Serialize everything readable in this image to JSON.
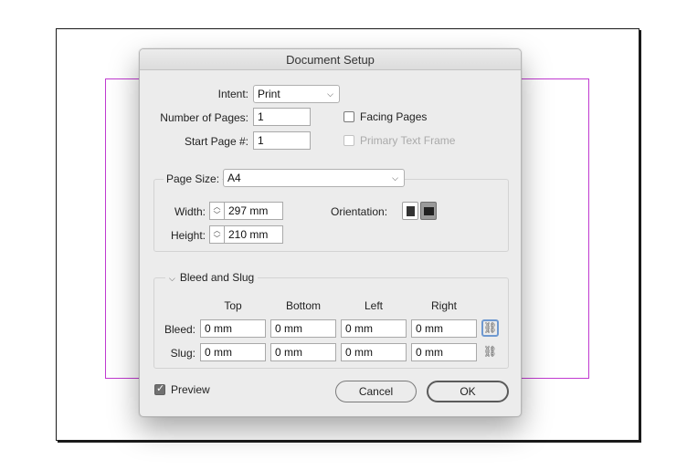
{
  "dialog": {
    "title": "Document Setup",
    "intent_label": "Intent:",
    "intent_value": "Print",
    "num_pages_label": "Number of Pages:",
    "num_pages_value": "1",
    "start_page_label": "Start Page #:",
    "start_page_value": "1",
    "facing_pages_label": "Facing Pages",
    "facing_pages_checked": false,
    "primary_text_frame_label": "Primary Text Frame",
    "primary_text_frame_checked": false,
    "page_size_label": "Page Size:",
    "page_size_value": "A4",
    "width_label": "Width:",
    "width_value": "297 mm",
    "height_label": "Height:",
    "height_value": "210 mm",
    "orientation_label": "Orientation:",
    "orientation_selected": "landscape",
    "bleed_slug": {
      "section_label": "Bleed and Slug",
      "columns": [
        "Top",
        "Bottom",
        "Left",
        "Right"
      ],
      "bleed_label": "Bleed:",
      "bleed_values": [
        "0 mm",
        "0 mm",
        "0 mm",
        "0 mm"
      ],
      "slug_label": "Slug:",
      "slug_values": [
        "0 mm",
        "0 mm",
        "0 mm",
        "0 mm"
      ]
    },
    "preview_label": "Preview",
    "preview_checked": true,
    "cancel_label": "Cancel",
    "ok_label": "OK"
  },
  "colors": {
    "margin_guide": "#c03ad0",
    "focus_ring": "#6f99d0"
  }
}
